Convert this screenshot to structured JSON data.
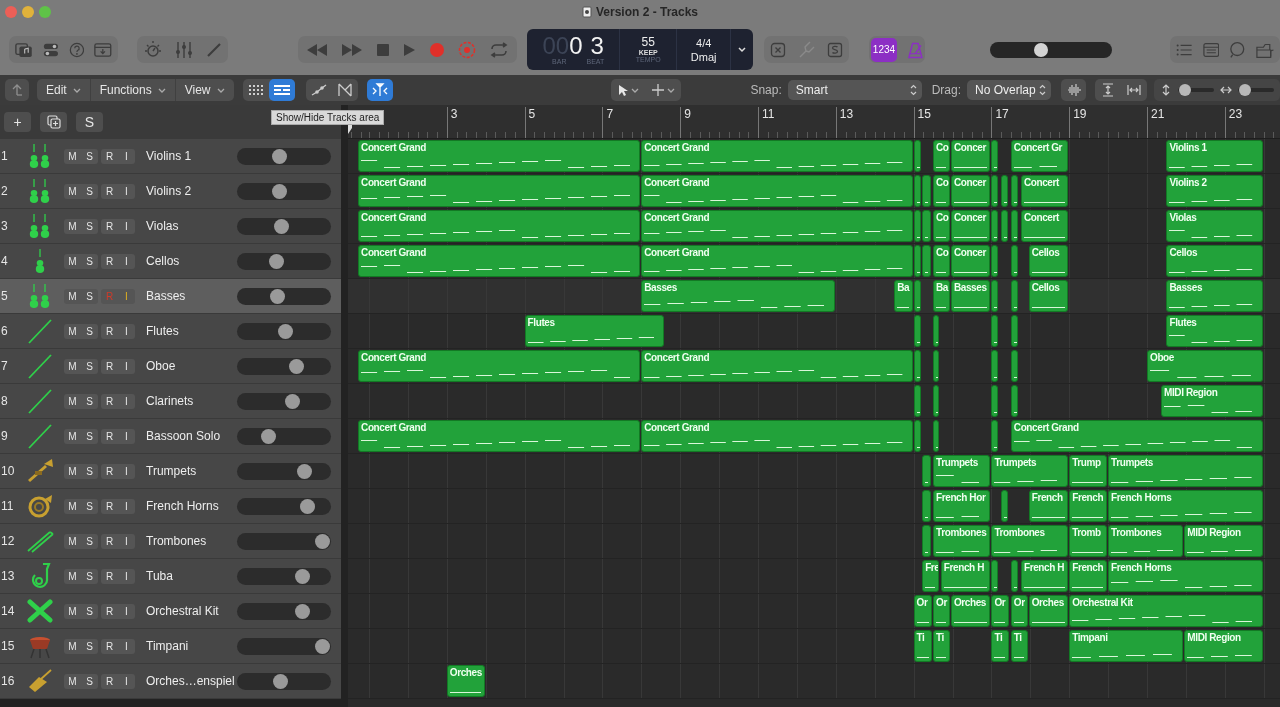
{
  "window": {
    "title": "Version 2 - Tracks"
  },
  "toolbar": {
    "lcd": {
      "bar_dim": "00",
      "bar": "0",
      "beat": "3",
      "bar_label": "BAR",
      "beat_label": "BEAT",
      "tempo": "55",
      "tempo_mode": "KEEP",
      "tempo_label": "TEMPO",
      "signature": "4/4",
      "key": "Dmaj"
    },
    "count_in": {
      "label": "1234",
      "on": true
    },
    "metronome": {
      "on": true
    },
    "master_volume": {
      "level": 0.4
    }
  },
  "control_bar": {
    "menus": [
      "Edit",
      "Functions",
      "View"
    ],
    "view_buttons": [
      {
        "kind": "grid",
        "selected": false
      },
      {
        "kind": "list",
        "selected": true
      }
    ],
    "catch": {
      "on": true
    },
    "snap_label": "Snap:",
    "snap": "Smart",
    "drag_label": "Drag:",
    "drag": "No Overlap",
    "vertical_zoom": {
      "level": 0.2
    },
    "horizontal_zoom": {
      "level": 0.2
    }
  },
  "track_header_buttons": [
    "+",
    "S"
  ],
  "tooltip": "Show/Hide Tracks area",
  "ruler": [
    "3",
    "5",
    "7",
    "9",
    "11",
    "13",
    "15",
    "17",
    "19",
    "21",
    "23"
  ],
  "tracks": [
    {
      "number": "1",
      "kind": "violin-pair",
      "name": "Violins 1",
      "buttons": [
        "M",
        "S",
        "R",
        "I"
      ],
      "record_armed": false,
      "input_monitoring": false,
      "selected": false,
      "level": 0.43,
      "regions": [
        {
          "kind": "midi",
          "name": "Concert Grand"
        },
        {
          "kind": "midi",
          "name": "Concert Grand"
        },
        {
          "kind": "midi"
        },
        {
          "kind": "midi",
          "name": "Co"
        },
        {
          "kind": "midi",
          "name": "Concer"
        },
        {
          "kind": "midi"
        },
        {
          "kind": "midi",
          "name": "Concert Gr"
        },
        {
          "kind": "midi",
          "name": "Violins 1"
        }
      ]
    },
    {
      "number": "2",
      "kind": "violin-pair",
      "name": "Violins 2",
      "buttons": [
        "M",
        "S",
        "R",
        "I"
      ],
      "record_armed": false,
      "input_monitoring": false,
      "selected": false,
      "level": 0.43,
      "regions": [
        {
          "kind": "midi",
          "name": "Concert Grand"
        },
        {
          "kind": "midi",
          "name": "Concert Grand"
        },
        {
          "kind": "midi"
        },
        {
          "kind": "midi"
        },
        {
          "kind": "midi",
          "name": "Co"
        },
        {
          "kind": "midi",
          "name": "Concer"
        },
        {
          "kind": "midi"
        },
        {
          "kind": "midi"
        },
        {
          "kind": "midi"
        },
        {
          "kind": "midi",
          "name": "Concert"
        },
        {
          "kind": "midi",
          "name": "Violins 2"
        }
      ]
    },
    {
      "number": "3",
      "kind": "violin-pair",
      "name": "Violas",
      "buttons": [
        "M",
        "S",
        "R",
        "I"
      ],
      "record_armed": false,
      "input_monitoring": false,
      "selected": false,
      "level": 0.46,
      "regions": [
        {
          "kind": "midi",
          "name": "Concert Grand"
        },
        {
          "kind": "midi",
          "name": "Concert Grand"
        },
        {
          "kind": "midi"
        },
        {
          "kind": "midi"
        },
        {
          "kind": "midi",
          "name": "Co"
        },
        {
          "kind": "midi",
          "name": "Concer"
        },
        {
          "kind": "midi"
        },
        {
          "kind": "midi"
        },
        {
          "kind": "midi"
        },
        {
          "kind": "midi",
          "name": "Concert"
        },
        {
          "kind": "midi",
          "name": "Violas"
        }
      ]
    },
    {
      "number": "4",
      "kind": "violin",
      "name": "Cellos",
      "buttons": [
        "M",
        "S",
        "R",
        "I"
      ],
      "record_armed": false,
      "input_monitoring": false,
      "selected": false,
      "level": 0.4,
      "regions": [
        {
          "kind": "midi",
          "name": "Concert Grand"
        },
        {
          "kind": "midi",
          "name": "Concert Grand"
        },
        {
          "kind": "midi"
        },
        {
          "kind": "midi"
        },
        {
          "kind": "midi",
          "name": "Co"
        },
        {
          "kind": "midi",
          "name": "Concer"
        },
        {
          "kind": "midi"
        },
        {
          "kind": "midi"
        },
        {
          "kind": "midi",
          "name": "Cellos"
        },
        {
          "kind": "midi",
          "name": "Cellos"
        }
      ]
    },
    {
      "number": "5",
      "kind": "violin-pair",
      "name": "Basses",
      "buttons": [
        "M",
        "S",
        "R",
        "I"
      ],
      "record_armed": true,
      "input_monitoring": true,
      "selected": true,
      "level": 0.41,
      "regions": [
        {
          "kind": "midi",
          "name": "Basses"
        },
        {
          "kind": "midi",
          "name": "Ba"
        },
        {
          "kind": "midi"
        },
        {
          "kind": "midi",
          "name": "Ba"
        },
        {
          "kind": "midi",
          "name": "Basses"
        },
        {
          "kind": "midi"
        },
        {
          "kind": "midi"
        },
        {
          "kind": "midi",
          "name": "Cellos"
        },
        {
          "kind": "midi",
          "name": "Basses"
        }
      ]
    },
    {
      "number": "6",
      "kind": "woodwind",
      "name": "Flutes",
      "buttons": [
        "M",
        "S",
        "R",
        "I"
      ],
      "record_armed": false,
      "input_monitoring": false,
      "selected": false,
      "level": 0.51,
      "regions": [
        {
          "kind": "midi",
          "name": "Flutes"
        },
        {
          "kind": "midi"
        },
        {
          "kind": "midi"
        },
        {
          "kind": "midi"
        },
        {
          "kind": "midi"
        },
        {
          "kind": "midi",
          "name": "Flutes"
        }
      ]
    },
    {
      "number": "7",
      "kind": "woodwind",
      "name": "Oboe",
      "buttons": [
        "M",
        "S",
        "R",
        "I"
      ],
      "record_armed": false,
      "input_monitoring": false,
      "selected": false,
      "level": 0.65,
      "regions": [
        {
          "kind": "midi",
          "name": "Concert Grand"
        },
        {
          "kind": "midi",
          "name": "Concert Grand"
        },
        {
          "kind": "midi"
        },
        {
          "kind": "midi"
        },
        {
          "kind": "midi"
        },
        {
          "kind": "midi"
        },
        {
          "kind": "midi",
          "name": "Oboe"
        }
      ]
    },
    {
      "number": "8",
      "kind": "woodwind",
      "name": "Clarinets",
      "buttons": [
        "M",
        "S",
        "R",
        "I"
      ],
      "record_armed": false,
      "input_monitoring": false,
      "selected": false,
      "level": 0.6,
      "regions": [
        {
          "kind": "midi"
        },
        {
          "kind": "midi"
        },
        {
          "kind": "midi"
        },
        {
          "kind": "midi"
        },
        {
          "kind": "midi",
          "name": "MIDI Region"
        }
      ]
    },
    {
      "number": "9",
      "kind": "woodwind",
      "name": "Bassoon Solo",
      "buttons": [
        "M",
        "S",
        "R",
        "I"
      ],
      "record_armed": false,
      "input_monitoring": false,
      "selected": false,
      "level": 0.3,
      "regions": [
        {
          "kind": "midi",
          "name": "Concert Grand"
        },
        {
          "kind": "midi",
          "name": "Concert Grand"
        },
        {
          "kind": "midi"
        },
        {
          "kind": "midi"
        },
        {
          "kind": "midi"
        },
        {
          "kind": "midi",
          "name": "Concert Grand"
        }
      ]
    },
    {
      "number": "10",
      "kind": "trumpet",
      "name": "Trumpets",
      "buttons": [
        "M",
        "S",
        "R",
        "I"
      ],
      "record_armed": false,
      "input_monitoring": false,
      "selected": false,
      "level": 0.76,
      "regions": [
        {
          "kind": "midi"
        },
        {
          "kind": "midi",
          "name": "Trumpets"
        },
        {
          "kind": "midi",
          "name": "Trumpets"
        },
        {
          "kind": "midi",
          "name": "Trump"
        },
        {
          "kind": "midi",
          "name": "Trumpets"
        }
      ]
    },
    {
      "number": "11",
      "kind": "horn",
      "name": "French Horns",
      "buttons": [
        "M",
        "S",
        "R",
        "I"
      ],
      "record_armed": false,
      "input_monitoring": false,
      "selected": false,
      "level": 0.8,
      "regions": [
        {
          "kind": "midi"
        },
        {
          "kind": "midi",
          "name": "French Hor"
        },
        {
          "kind": "midi"
        },
        {
          "kind": "midi",
          "name": "French"
        },
        {
          "kind": "midi",
          "name": "French"
        },
        {
          "kind": "midi",
          "name": "French Horns"
        }
      ]
    },
    {
      "number": "12",
      "kind": "trombone",
      "name": "Trombones",
      "buttons": [
        "M",
        "S",
        "R",
        "I"
      ],
      "record_armed": false,
      "input_monitoring": false,
      "selected": false,
      "level": 0.99,
      "regions": [
        {
          "kind": "midi"
        },
        {
          "kind": "midi",
          "name": "Trombones"
        },
        {
          "kind": "midi",
          "name": "Trombones"
        },
        {
          "kind": "midi",
          "name": "Tromb"
        },
        {
          "kind": "midi",
          "name": "Trombones"
        },
        {
          "kind": "midi",
          "name": "MIDI Region"
        }
      ]
    },
    {
      "number": "13",
      "kind": "tuba",
      "name": "Tuba",
      "buttons": [
        "M",
        "S",
        "R",
        "I"
      ],
      "record_armed": false,
      "input_monitoring": false,
      "selected": false,
      "level": 0.73,
      "regions": [
        {
          "kind": "midi",
          "name": "Fre"
        },
        {
          "kind": "midi",
          "name": "French H"
        },
        {
          "kind": "midi"
        },
        {
          "kind": "midi"
        },
        {
          "kind": "midi",
          "name": "French H"
        },
        {
          "kind": "midi",
          "name": "French"
        },
        {
          "kind": "midi",
          "name": "French Horns"
        }
      ]
    },
    {
      "number": "14",
      "kind": "sticks",
      "name": "Orchestral Kit",
      "buttons": [
        "M",
        "S",
        "R",
        "I"
      ],
      "record_armed": false,
      "input_monitoring": false,
      "selected": false,
      "level": 0.73,
      "regions": [
        {
          "kind": "midi",
          "name": "Or"
        },
        {
          "kind": "midi",
          "name": "Or"
        },
        {
          "kind": "midi",
          "name": "Orches"
        },
        {
          "kind": "midi",
          "name": "Or"
        },
        {
          "kind": "midi",
          "name": "Or"
        },
        {
          "kind": "midi",
          "name": "Orches"
        },
        {
          "kind": "midi",
          "name": "Orchestral Kit"
        }
      ]
    },
    {
      "number": "15",
      "kind": "timpani",
      "name": "Timpani",
      "buttons": [
        "M",
        "S",
        "R",
        "I"
      ],
      "record_armed": false,
      "input_monitoring": false,
      "selected": false,
      "level": 0.99,
      "regions": [
        {
          "kind": "midi",
          "name": "Ti"
        },
        {
          "kind": "midi",
          "name": "Ti"
        },
        {
          "kind": "midi",
          "name": "Ti"
        },
        {
          "kind": "midi",
          "name": "Ti"
        },
        {
          "kind": "midi",
          "name": "Timpani"
        },
        {
          "kind": "midi",
          "name": "MIDI Region"
        }
      ]
    },
    {
      "number": "16",
      "kind": "glockenspiel",
      "name": "Orches…enspiel",
      "buttons": [
        "M",
        "S",
        "R",
        "I"
      ],
      "record_armed": false,
      "input_monitoring": false,
      "selected": false,
      "level": 0.45,
      "regions": [
        {
          "kind": "midi",
          "name": "Orches"
        }
      ]
    }
  ]
}
